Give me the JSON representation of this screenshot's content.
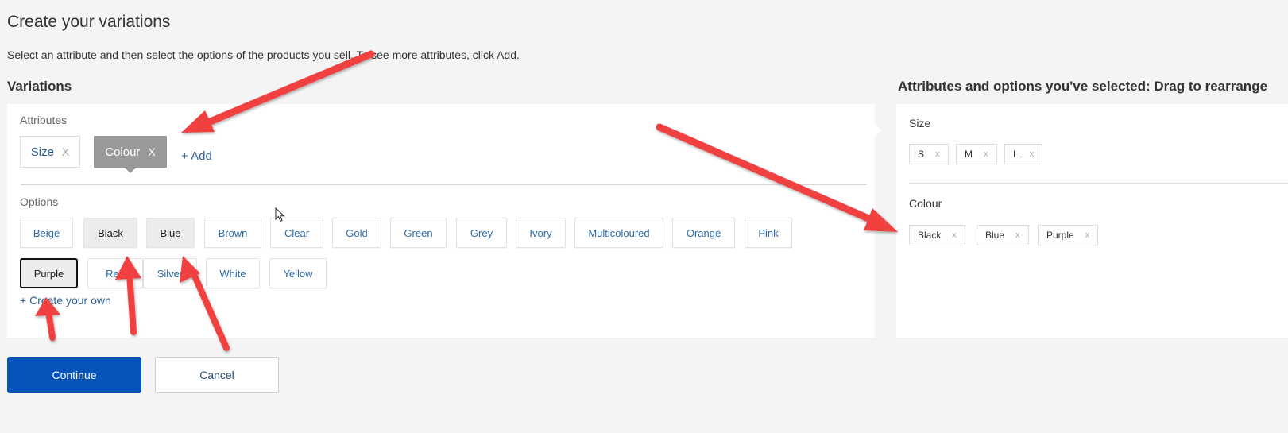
{
  "page": {
    "title": "Create your variations",
    "subtitle": "Select an attribute and then select the options of the products you sell. To see more attributes, click Add.",
    "section_title": "Variations",
    "right_title": "Attributes and options you've selected: Drag to rearrange"
  },
  "attributes": {
    "label": "Attributes",
    "items": [
      {
        "label": "Size",
        "remove": "X",
        "active": false
      },
      {
        "label": "Colour",
        "remove": "X",
        "active": true
      }
    ],
    "add_label": "+ Add"
  },
  "options": {
    "label": "Options",
    "items": [
      {
        "label": "Beige",
        "state": "none"
      },
      {
        "label": "Black",
        "state": "selected"
      },
      {
        "label": "Blue",
        "state": "selected"
      },
      {
        "label": "Brown",
        "state": "none"
      },
      {
        "label": "Clear",
        "state": "none"
      },
      {
        "label": "Gold",
        "state": "none"
      },
      {
        "label": "Green",
        "state": "none"
      },
      {
        "label": "Grey",
        "state": "none"
      },
      {
        "label": "Ivory",
        "state": "none"
      },
      {
        "label": "Multicoloured",
        "state": "none"
      },
      {
        "label": "Orange",
        "state": "none"
      },
      {
        "label": "Pink",
        "state": "none"
      },
      {
        "label": "Purple",
        "state": "focused"
      },
      {
        "label": "Red",
        "state": "none"
      },
      {
        "label": "Silver",
        "state": "none"
      },
      {
        "label": "White",
        "state": "none"
      },
      {
        "label": "Yellow",
        "state": "none"
      }
    ],
    "create_label": "+ Create your own"
  },
  "selected": {
    "groups": [
      {
        "name": "Size",
        "values": [
          {
            "label": "S",
            "remove": "x"
          },
          {
            "label": "M",
            "remove": "x"
          },
          {
            "label": "L",
            "remove": "x"
          }
        ]
      },
      {
        "name": "Colour",
        "values": [
          {
            "label": "Black",
            "remove": "x"
          },
          {
            "label": "Blue",
            "remove": "x"
          },
          {
            "label": "Purple",
            "remove": "x"
          }
        ]
      }
    ]
  },
  "actions": {
    "continue_label": "Continue",
    "cancel_label": "Cancel"
  },
  "colors": {
    "primary": "#0654ba",
    "link": "#2d5f96",
    "annotation_arrow": "#f04040",
    "active_attribute": "#999999"
  }
}
